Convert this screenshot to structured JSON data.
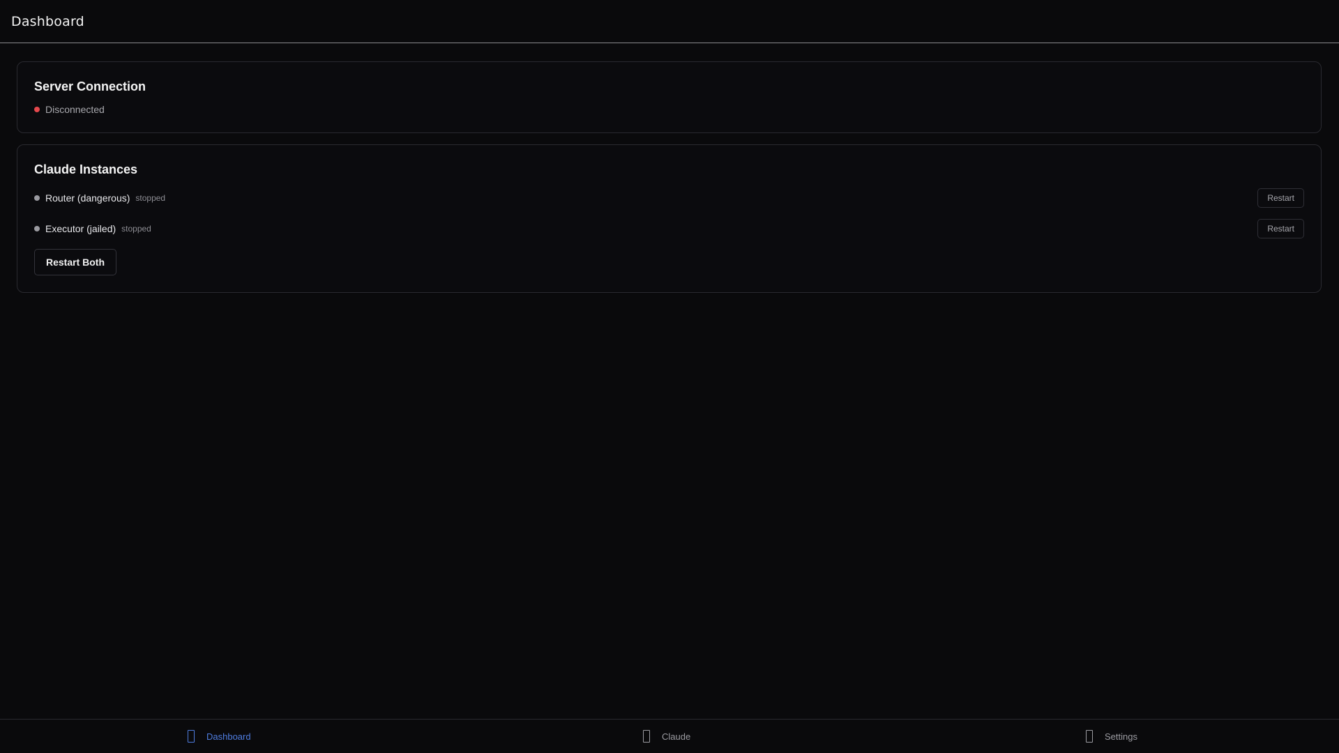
{
  "header": {
    "title": "Dashboard"
  },
  "server_connection": {
    "title": "Server Connection",
    "status": "Disconnected",
    "status_color": "#e5484d"
  },
  "instances": {
    "title": "Claude Instances",
    "items": [
      {
        "name": "Router (dangerous)",
        "state": "stopped",
        "restart_label": "Restart",
        "dot_color": "#9a9aa0"
      },
      {
        "name": "Executor (jailed)",
        "state": "stopped",
        "restart_label": "Restart",
        "dot_color": "#9a9aa0"
      }
    ],
    "restart_both_label": "Restart Both"
  },
  "nav": {
    "items": [
      {
        "label": "Dashboard",
        "icon": "dashboard-icon",
        "active": true
      },
      {
        "label": "Claude",
        "icon": "claude-icon",
        "active": false
      },
      {
        "label": "Settings",
        "icon": "settings-icon",
        "active": false
      }
    ],
    "active_color": "#4f7de0",
    "inactive_color": "#9c9ca2"
  }
}
